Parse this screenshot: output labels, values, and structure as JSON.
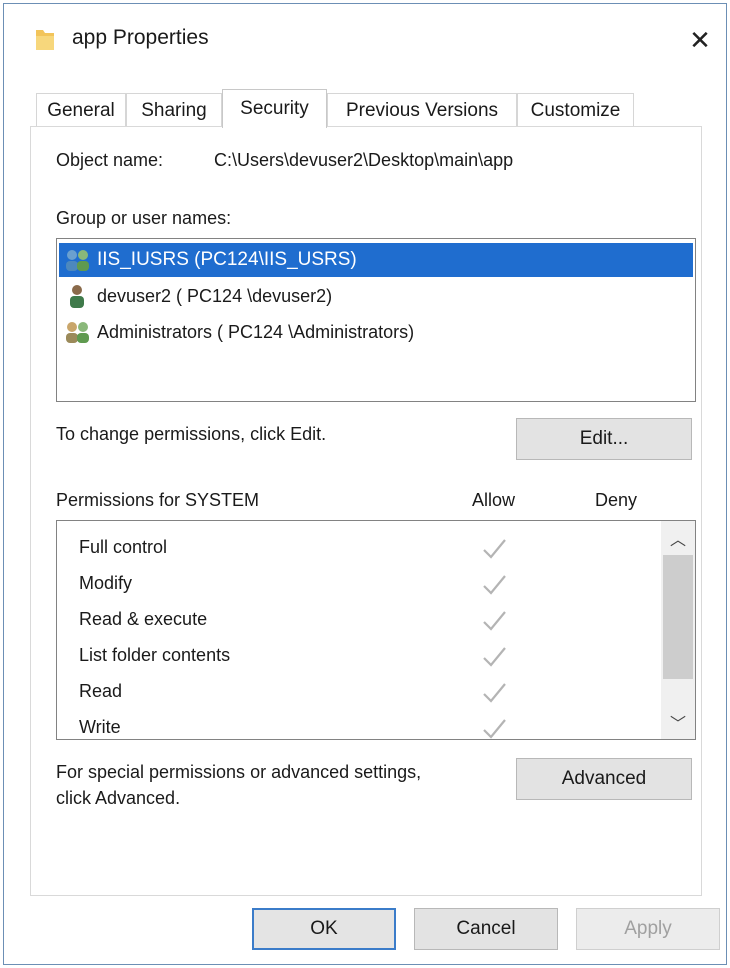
{
  "window": {
    "title": "app Properties",
    "close_glyph": "✕"
  },
  "tabs": [
    {
      "label": "General",
      "active": false
    },
    {
      "label": "Sharing",
      "active": false
    },
    {
      "label": "Security",
      "active": true
    },
    {
      "label": "Previous Versions",
      "active": false
    },
    {
      "label": "Customize",
      "active": false
    }
  ],
  "security": {
    "object_name_label": "Object name:",
    "object_name_value": "C:\\Users\\devuser2\\Desktop\\main\\app",
    "group_label": "Group or user names:",
    "users": [
      {
        "name": "IIS_IUSRS (PC124\\IIS_USRS)",
        "icon": "group-users-icon",
        "selected": true
      },
      {
        "name": "devuser2 ( PC124 \\devuser2)",
        "icon": "user-icon",
        "selected": false
      },
      {
        "name": "Administrators ( PC124 \\Administrators)",
        "icon": "group-users-icon",
        "selected": false
      }
    ],
    "change_hint": "To change permissions, click Edit.",
    "edit_button": "Edit...",
    "permissions_label": "Permissions for SYSTEM",
    "allow_header": "Allow",
    "deny_header": "Deny",
    "permissions": [
      {
        "name": "Full control",
        "allow": true,
        "deny": false
      },
      {
        "name": "Modify",
        "allow": true,
        "deny": false
      },
      {
        "name": "Read & execute",
        "allow": true,
        "deny": false
      },
      {
        "name": "List folder contents",
        "allow": true,
        "deny": false
      },
      {
        "name": "Read",
        "allow": true,
        "deny": false
      },
      {
        "name": "Write",
        "allow": true,
        "deny": false
      }
    ],
    "advanced_hint_line1": "For special permissions or advanced settings,",
    "advanced_hint_line2": "click Advanced.",
    "advanced_button": "Advanced"
  },
  "footer": {
    "ok": "OK",
    "cancel": "Cancel",
    "apply": "Apply"
  },
  "colors": {
    "selection": "#1f6dcf",
    "default_button_border": "#3b7cc9",
    "folder": "#f2c45a"
  }
}
